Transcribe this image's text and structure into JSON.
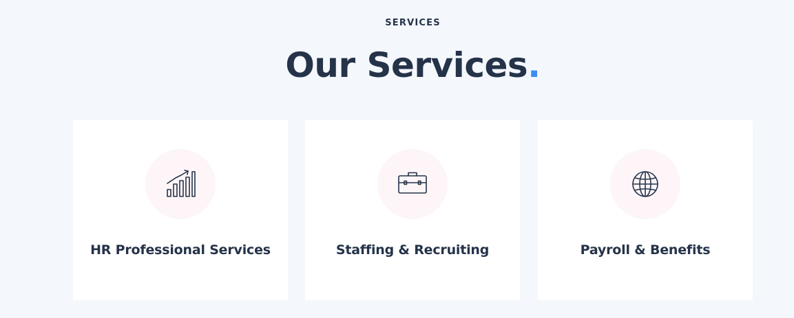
{
  "section": {
    "eyebrow": "SERVICES",
    "title": "Our Services",
    "title_dot": ".",
    "accent_color": "#3d8bf2",
    "text_color": "#253349",
    "background_color": "#f4f7fc",
    "icon_bg_color": "#fdf5f7"
  },
  "services": [
    {
      "title": "HR Professional Services",
      "icon": "bar-chart-growth-icon"
    },
    {
      "title": "Staffing & Recruiting",
      "icon": "briefcase-icon"
    },
    {
      "title": "Payroll & Benefits",
      "icon": "globe-icon"
    }
  ]
}
